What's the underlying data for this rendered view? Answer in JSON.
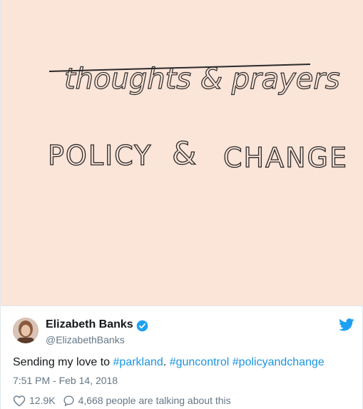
{
  "media": {
    "line1": "thoughts & prayers",
    "line2_left": "POLICY",
    "line2_amp": "&",
    "line2_right": "CHANGE"
  },
  "author": {
    "name": "Elizabeth Banks",
    "handle": "@ElizabethBanks",
    "verified": true
  },
  "tweet": {
    "text_before": "Sending my love to ",
    "tag1": "#parkland",
    "sep1": ". ",
    "tag2": "#guncontrol",
    "sep2": " ",
    "tag3": "#policyandchange"
  },
  "timestamp": "7:51 PM - Feb 14, 2018",
  "actions": {
    "likes": "12.9K",
    "talking": "4,668 people are talking about this"
  },
  "colors": {
    "media_background": "#fbe4d8",
    "link": "#1b95e0",
    "secondary_text": "#657786",
    "verified": "#1da1f2"
  }
}
